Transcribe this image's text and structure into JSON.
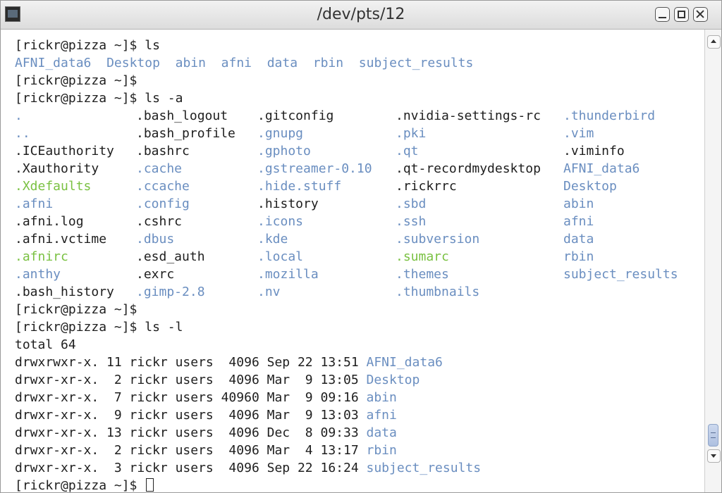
{
  "window": {
    "title": "/dev/pts/12"
  },
  "colors": {
    "directory": "#6a8ec0",
    "executable": "#7ac142",
    "text": "#1e1e1e"
  },
  "terminal": {
    "prompt": "[rickr@pizza ~]$",
    "ls_output": [
      "AFNI_data6",
      "Desktop",
      "abin",
      "afni",
      "data",
      "rbin",
      "subject_results"
    ],
    "ls_a_rows": [
      [
        ".",
        ".bash_logout",
        ".gitconfig",
        ".nvidia-settings-rc",
        ".thunderbird"
      ],
      [
        "..",
        ".bash_profile",
        ".gnupg",
        ".pki",
        ".vim"
      ],
      [
        ".ICEauthority",
        ".bashrc",
        ".gphoto",
        ".qt",
        ".viminfo"
      ],
      [
        ".Xauthority",
        ".cache",
        ".gstreamer-0.10",
        ".qt-recordmydesktop",
        "AFNI_data6"
      ],
      [
        ".Xdefaults",
        ".ccache",
        ".hide.stuff",
        ".rickrrc",
        "Desktop"
      ],
      [
        ".afni",
        ".config",
        ".history",
        ".sbd",
        "abin"
      ],
      [
        ".afni.log",
        ".cshrc",
        ".icons",
        ".ssh",
        "afni"
      ],
      [
        ".afni.vctime",
        ".dbus",
        ".kde",
        ".subversion",
        "data"
      ],
      [
        ".afnirc",
        ".esd_auth",
        ".local",
        ".sumarc",
        "rbin"
      ],
      [
        ".anthy",
        ".exrc",
        ".mozilla",
        ".themes",
        "subject_results"
      ],
      [
        ".bash_history",
        ".gimp-2.8",
        ".nv",
        ".thumbnails",
        ""
      ]
    ],
    "ls_a_types": [
      [
        "dir",
        "file",
        "file",
        "file",
        "dir"
      ],
      [
        "dir",
        "file",
        "dir",
        "dir",
        "dir"
      ],
      [
        "file",
        "file",
        "dir",
        "dir",
        "file"
      ],
      [
        "file",
        "dir",
        "dir",
        "file",
        "dir"
      ],
      [
        "exe",
        "dir",
        "dir",
        "file",
        "dir"
      ],
      [
        "dir",
        "dir",
        "file",
        "dir",
        "dir"
      ],
      [
        "file",
        "file",
        "dir",
        "dir",
        "dir"
      ],
      [
        "file",
        "dir",
        "dir",
        "dir",
        "dir"
      ],
      [
        "exe",
        "file",
        "dir",
        "exe",
        "dir"
      ],
      [
        "dir",
        "file",
        "dir",
        "dir",
        "dir"
      ],
      [
        "file",
        "dir",
        "dir",
        "dir",
        "file"
      ]
    ],
    "total_line": "total 64",
    "ls_l_rows": [
      {
        "meta": "drwxrwxr-x. 11 rickr users  4096 Sep 22 13:51 ",
        "name": "AFNI_data6"
      },
      {
        "meta": "drwxr-xr-x.  2 rickr users  4096 Mar  9 13:05 ",
        "name": "Desktop"
      },
      {
        "meta": "drwxr-xr-x.  7 rickr users 40960 Mar  9 09:16 ",
        "name": "abin"
      },
      {
        "meta": "drwxr-xr-x.  9 rickr users  4096 Mar  9 13:03 ",
        "name": "afni"
      },
      {
        "meta": "drwxr-xr-x. 13 rickr users  4096 Dec  8 09:33 ",
        "name": "data"
      },
      {
        "meta": "drwxr-xr-x.  2 rickr users  4096 Mar  4 13:17 ",
        "name": "rbin"
      },
      {
        "meta": "drwxr-xr-x.  3 rickr users  4096 Sep 22 16:24 ",
        "name": "subject_results"
      }
    ]
  }
}
